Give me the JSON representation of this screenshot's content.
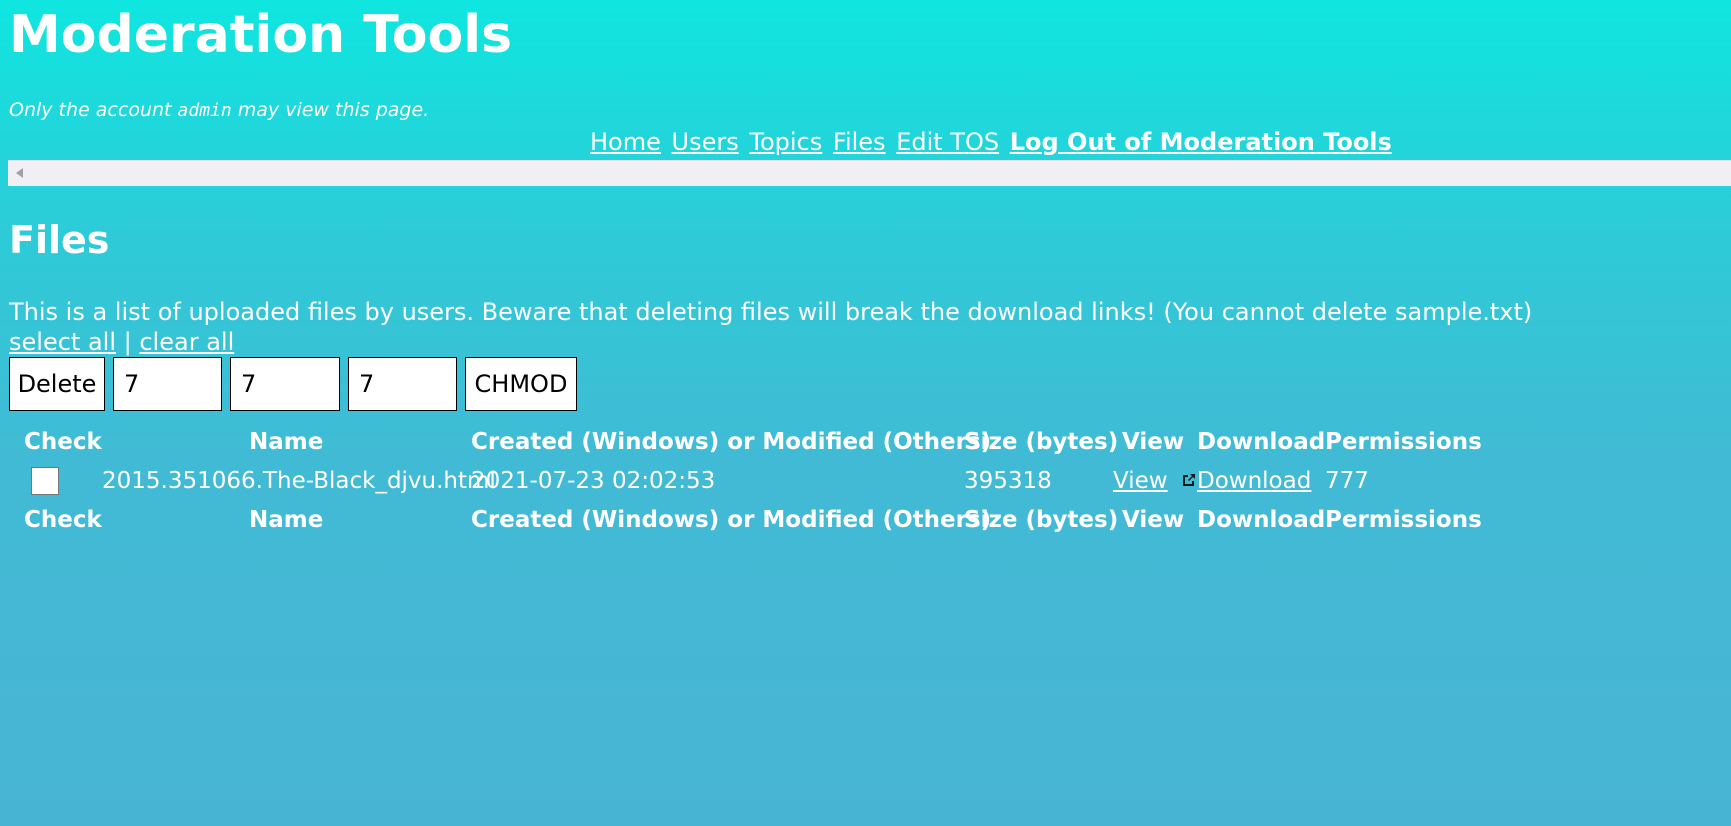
{
  "header": {
    "title": "Moderation Tools",
    "notice_prefix": "Only the account",
    "notice_account": "admin",
    "notice_suffix": "may view this page."
  },
  "nav": {
    "items": [
      "Home",
      "Users",
      "Topics",
      "Files",
      "Edit TOS"
    ],
    "logout": "Log Out of Moderation Tools"
  },
  "section": {
    "heading": "Files",
    "description": "This is a list of uploaded files by users. Beware that deleting files will break the download links! (You cannot delete sample.txt)",
    "select_all": "select all",
    "separator": "|",
    "clear_all": "clear all"
  },
  "controls": {
    "delete_label": "Delete",
    "perm_owner": "7",
    "perm_group": "7",
    "perm_other": "7",
    "chmod_label": "CHMOD"
  },
  "table": {
    "columns": [
      "Check",
      "Name",
      "Created (Windows) or Modified (Others)",
      "Size (bytes)",
      "View",
      "Download",
      "Permissions"
    ],
    "rows": [
      {
        "checked": false,
        "name": "2015.351066.The-Black_djvu.html",
        "created": "2021-07-23 02:02:53",
        "size": "395318",
        "view": "View",
        "view_icon": "external-link-icon",
        "download": "Download",
        "permissions": "777"
      }
    ]
  }
}
